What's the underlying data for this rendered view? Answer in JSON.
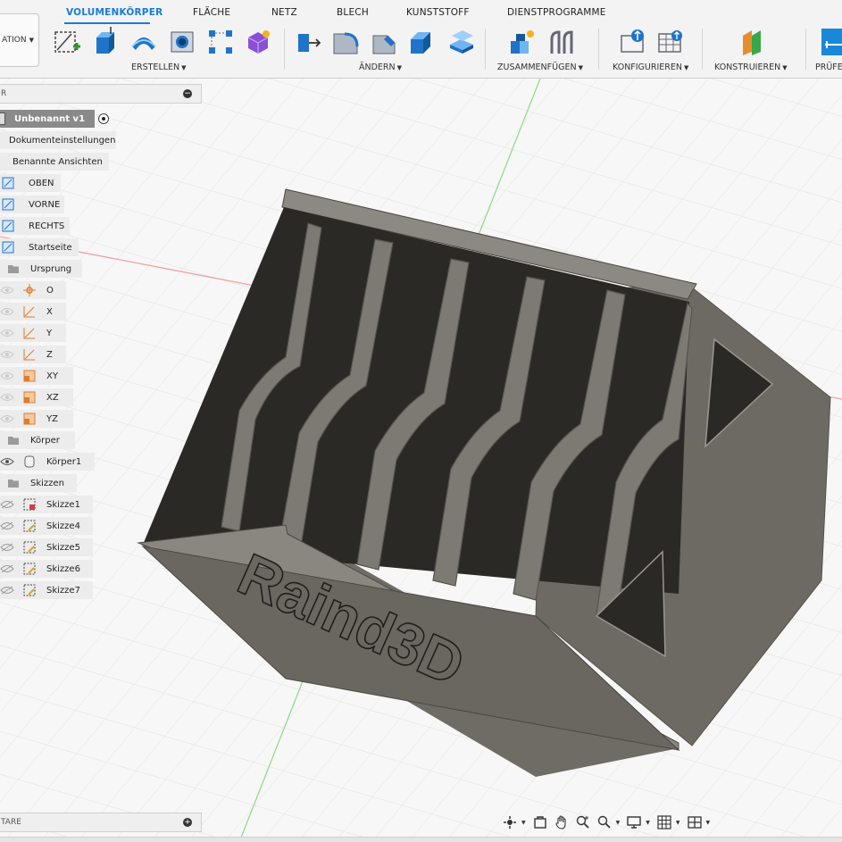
{
  "toolbar": {
    "workspace_label": "ATION",
    "tabs": [
      {
        "label": "VOLUMENKÖRPER",
        "active": true
      },
      {
        "label": "FLÄCHE"
      },
      {
        "label": "NETZ"
      },
      {
        "label": "BLECH"
      },
      {
        "label": "KUNSTSTOFF"
      },
      {
        "label": "DIENSTPROGRAMME"
      }
    ],
    "groups": {
      "erstellen": "ERSTELLEN",
      "aendern": "ÄNDERN",
      "zusammenfuegen": "ZUSAMMENFÜGEN",
      "konfigurieren": "KONFIGURIEREN",
      "konstruieren": "KONSTRUIEREN",
      "pruefen": "PRÜFE"
    }
  },
  "browser": {
    "header": "R",
    "root_label": "Unbenannt v1",
    "items": {
      "dokumenteinstellungen": "Dokumenteinstellungen",
      "benannte_ansichten": "Benannte Ansichten",
      "oben": "OBEN",
      "vorne": "VORNE",
      "rechts": "RECHTS",
      "startseite": "Startseite",
      "ursprung": "Ursprung",
      "o": "O",
      "x": "X",
      "y": "Y",
      "z": "Z",
      "xy": "XY",
      "xz": "XZ",
      "yz": "YZ",
      "koerper": "Körper",
      "koerper1": "Körper1",
      "skizzen": "Skizzen",
      "skizze1": "Skizze1",
      "skizze4": "Skizze4",
      "skizze5": "Skizze5",
      "skizze6": "Skizze6",
      "skizze7": "Skizze7"
    }
  },
  "comments": {
    "label": "TARE"
  },
  "model": {
    "embossed_text": "Raind3D"
  },
  "colors": {
    "accent": "#1a7bd4",
    "grid_green": "#7ed67e",
    "grid_red": "#f08a8a",
    "model_face": "#6e6b65",
    "model_dark": "#2c2a27"
  }
}
